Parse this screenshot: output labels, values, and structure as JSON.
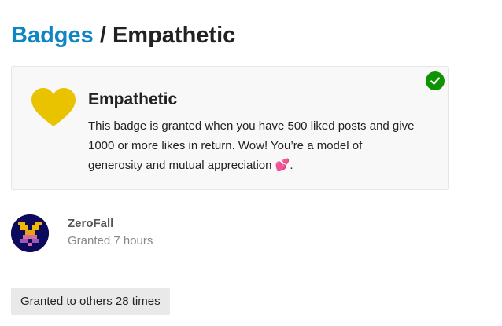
{
  "breadcrumb": {
    "link": "Badges",
    "separator": "/",
    "current": "Empathetic"
  },
  "badge": {
    "name": "Empathetic",
    "description": "This badge is granted when you have 500 liked posts and give 1000 or more likes in return. Wow! You’re a model of generosity and mutual appreciation",
    "description_end": ".",
    "emoji": "💕",
    "icon": "heart-icon",
    "icon_color": "#e9c300",
    "granted_status_icon": "check-circle-icon",
    "granted_status_color": "#0d9400"
  },
  "user": {
    "username": "ZeroFall",
    "granted_text": "Granted 7 hours"
  },
  "others_button": "Granted to others 28 times",
  "colors": {
    "link": "#0f85c4",
    "card_bg": "#f8f8f8",
    "button_bg": "#e9e9e9"
  }
}
